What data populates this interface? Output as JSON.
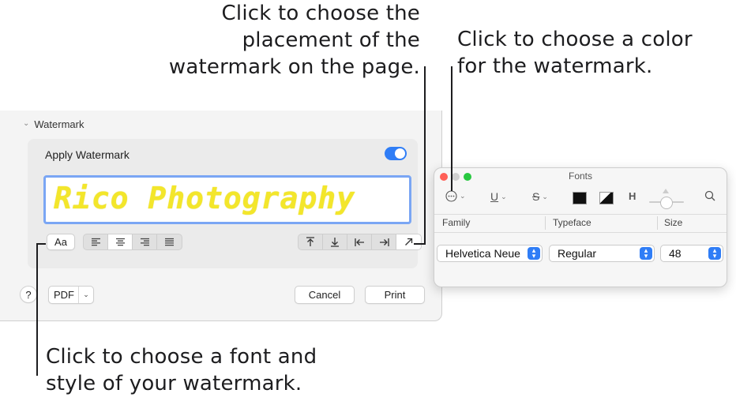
{
  "callouts": {
    "placement": "Click to choose the\nplacement of the\nwatermark on the page.",
    "color": "Click to choose a color\nfor the watermark.",
    "font": "Click to choose a font and\nstyle of your watermark."
  },
  "print_dialog": {
    "section_title": "Watermark",
    "apply_label": "Apply Watermark",
    "apply_on": true,
    "watermark_text": "Rico Photography",
    "watermark_color": "#f3e62b",
    "font_button": "Aa",
    "align_icons": [
      "align-left-icon",
      "align-center-icon",
      "align-right-icon",
      "justify-icon"
    ],
    "placement_icons": [
      "top-icon",
      "bottom-icon",
      "left-icon",
      "right-icon",
      "diagonal-icon"
    ],
    "help": "?",
    "pdf": "PDF",
    "cancel": "Cancel",
    "print": "Print"
  },
  "fonts_panel": {
    "title": "Fonts",
    "columns": [
      "Family",
      "Typeface",
      "Size"
    ],
    "family": "Helvetica Neue",
    "typeface": "Regular",
    "size": "48"
  },
  "colors": {
    "accent": "#2f7df6",
    "close": "#ff5f57",
    "minimize": "#d0d0d0",
    "zoom": "#28c840"
  }
}
